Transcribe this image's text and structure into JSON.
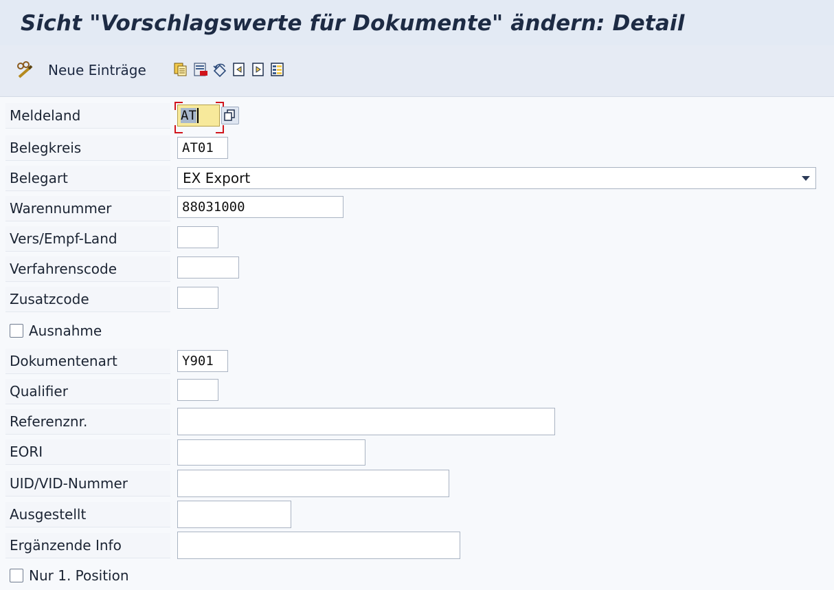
{
  "window": {
    "title": "Sicht \"Vorschlagswerte für Dokumente\" ändern: Detail"
  },
  "toolbar": {
    "new_entries_label": "Neue Einträge",
    "icons": [
      "glasses-pen-icon",
      "copy-as-icon",
      "delete-icon",
      "undo-change-icon",
      "previous-entry-icon",
      "next-entry-icon",
      "select-all-icon"
    ]
  },
  "form": {
    "meldeland": {
      "label": "Meldeland",
      "value": "AT"
    },
    "belegkreis": {
      "label": "Belegkreis",
      "value": "AT01"
    },
    "belegart": {
      "label": "Belegart",
      "value": "EX Export"
    },
    "warennummer": {
      "label": "Warennummer",
      "value": "88031000"
    },
    "vers_empf_land": {
      "label": "Vers/Empf-Land",
      "value": ""
    },
    "verfahrenscode": {
      "label": "Verfahrenscode",
      "value": ""
    },
    "zusatzcode": {
      "label": "Zusatzcode",
      "value": ""
    },
    "ausnahme": {
      "label": "Ausnahme",
      "checked": false
    },
    "dokumentenart": {
      "label": "Dokumentenart",
      "value": "Y901"
    },
    "qualifier": {
      "label": "Qualifier",
      "value": ""
    },
    "referenznr": {
      "label": "Referenznr.",
      "value": ""
    },
    "eori": {
      "label": "EORI",
      "value": ""
    },
    "uid_vid": {
      "label": "UID/VID-Nummer",
      "value": ""
    },
    "ausgestellt": {
      "label": "Ausgestellt",
      "value": ""
    },
    "ergaenzende_info": {
      "label": "Ergänzende Info",
      "value": ""
    },
    "nur_1_position": {
      "label": "Nur 1. Position",
      "checked": false
    }
  },
  "colors": {
    "title_bg": "#e3eaf4",
    "focus_field": "#f7e99b",
    "focus_corner": "#d1141b",
    "field_border": "#a9b3c2"
  }
}
